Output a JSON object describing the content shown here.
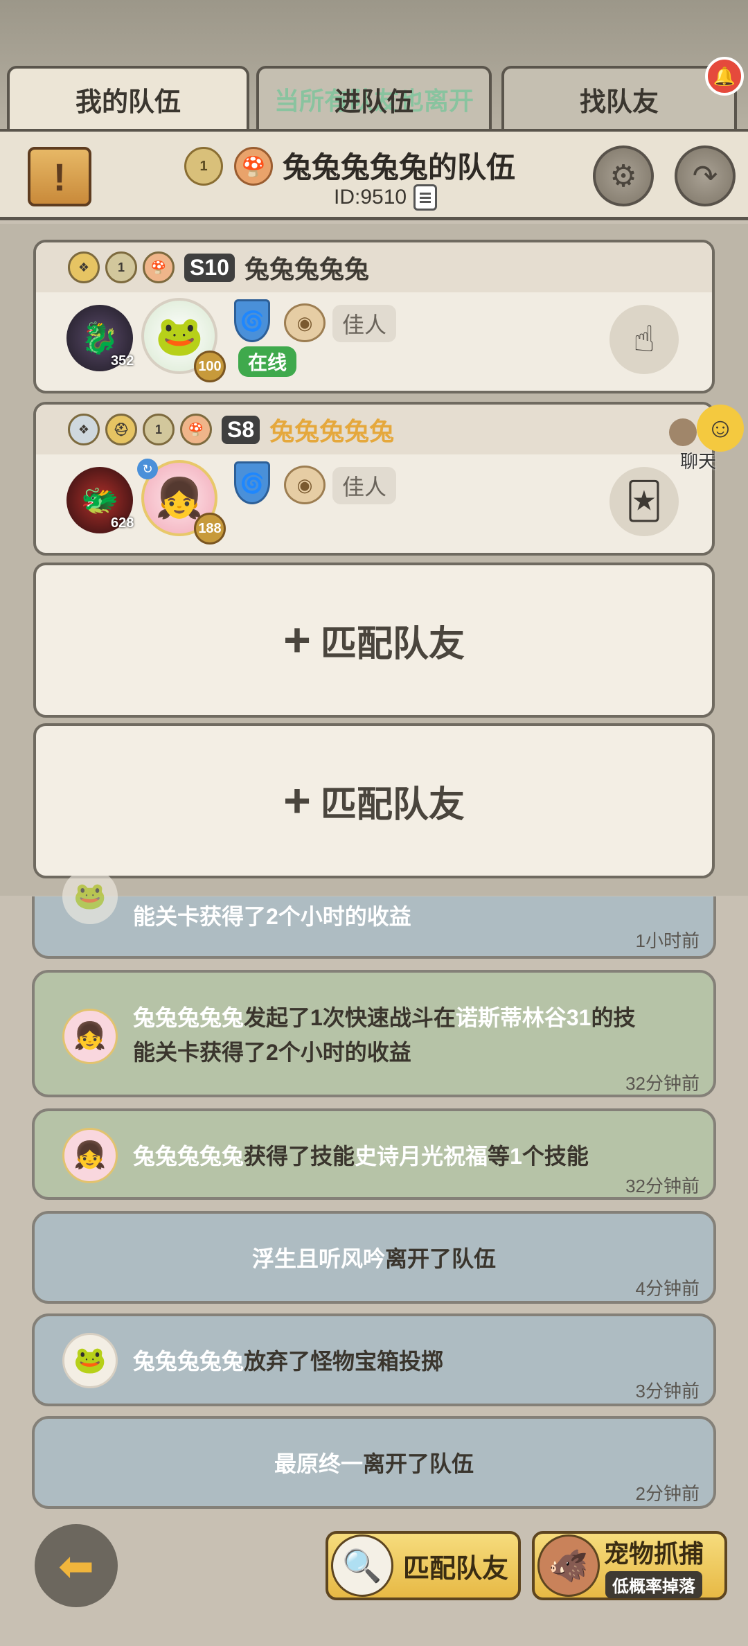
{
  "tabs": {
    "my_team": "我的队伍",
    "join_team": "进队伍",
    "join_team_overlay": "当所有队友也离开",
    "find_teammate": "找队友"
  },
  "header": {
    "team_name": "兔兔兔兔兔的队伍",
    "team_id": "ID:9510",
    "scroll_icon_glyph": "!",
    "rank_level": "1"
  },
  "members": [
    {
      "season": "S10",
      "name": "兔兔兔兔兔",
      "name_color": "#2e2a25",
      "pet_level": "352",
      "hero_level": "100",
      "title_tag": "佳人",
      "status": "在线",
      "badge_level": "1",
      "action_icon": "pointing-hand-star-icon"
    },
    {
      "season": "S8",
      "name": "兔兔兔兔兔",
      "name_color": "#e5a83c",
      "pet_level": "628",
      "hero_level": "188",
      "title_tag": "佳人",
      "badge_level": "1",
      "action_icon": "hand-card-star-icon"
    }
  ],
  "match_slots": [
    {
      "plus": "+",
      "label": "匹配队友"
    },
    {
      "plus": "+",
      "label": "匹配队友"
    }
  ],
  "chat": {
    "label": "聊天"
  },
  "logs": [
    {
      "type": "blue",
      "parts": [
        "能关卡获得了2个小时的收益"
      ],
      "time": "1小时前"
    },
    {
      "type": "green",
      "line1": [
        "兔兔兔兔兔",
        "发起了1次快速战斗在",
        "诺斯蒂林谷31",
        "的技"
      ],
      "line2": [
        "能关卡获得了2个小时的收益"
      ],
      "time": "32分钟前"
    },
    {
      "type": "green",
      "line1": [
        "兔兔兔兔兔",
        "获得了技能",
        "史诗月光祝福",
        "等",
        "1",
        "个技能"
      ],
      "time": "32分钟前"
    },
    {
      "type": "blue",
      "line1": [
        "浮生且听风吟",
        "离开了队伍"
      ],
      "time": "4分钟前"
    },
    {
      "type": "blue",
      "line1": [
        "兔兔兔兔兔",
        "放弃了怪物宝箱投掷"
      ],
      "time": "3分钟前"
    },
    {
      "type": "blue",
      "line1": [
        "最原终一",
        "离开了队伍"
      ],
      "time": "2分钟前"
    }
  ],
  "bottom": {
    "match_button": "匹配队友",
    "pet_capture_title": "宠物抓捕",
    "pet_capture_sub": "低概率掉落"
  },
  "colors": {
    "accent_gold": "#e7b945",
    "online_green": "#3fa94c",
    "notification_red": "#e54a3c"
  }
}
